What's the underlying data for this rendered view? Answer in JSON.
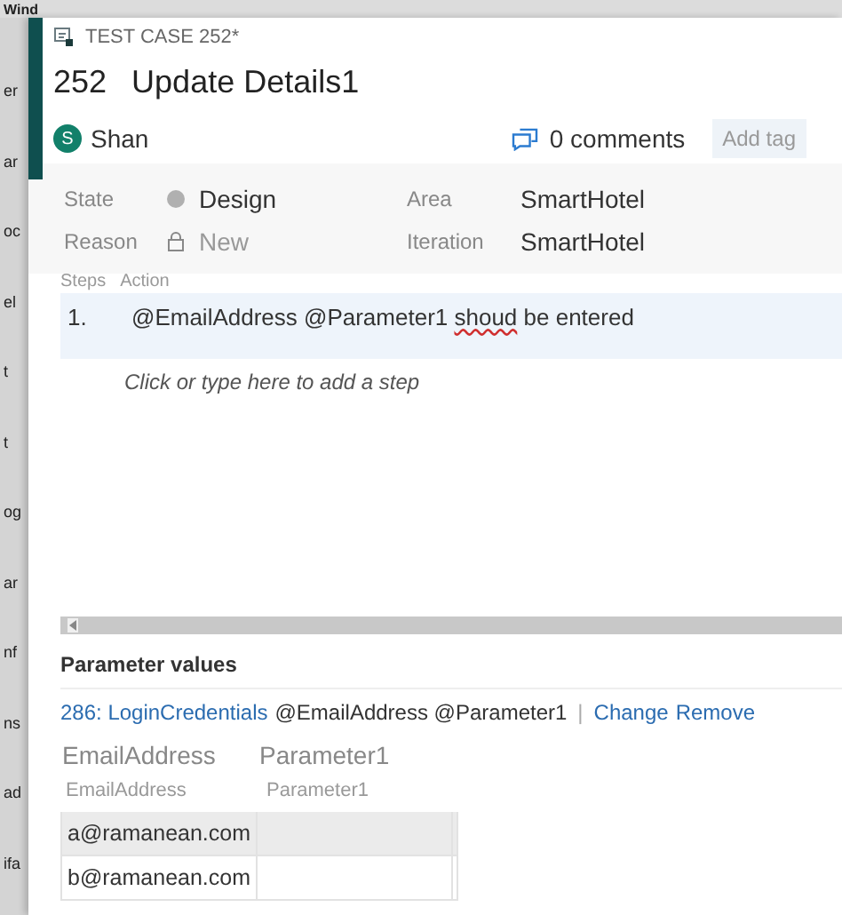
{
  "background": {
    "top_fragment": "Wind",
    "side_fragments": [
      "er",
      "ar",
      "oc",
      "el",
      "t",
      "t",
      "og",
      "ar",
      "nf",
      "ns",
      "ad",
      "ifa"
    ]
  },
  "work_item": {
    "type_label": "TEST CASE 252*",
    "id": "252",
    "title": "Update Details1",
    "assignee": {
      "initial": "S",
      "name": "Shan"
    },
    "comments": "0 comments",
    "add_tag": "Add tag"
  },
  "fields": [
    {
      "label": "State",
      "value": "Design",
      "kind": "state",
      "label2": "Area",
      "value2": "SmartHotel"
    },
    {
      "label": "Reason",
      "value": "New",
      "kind": "locked",
      "label2": "Iteration",
      "value2": "SmartHotel"
    }
  ],
  "steps": {
    "columns": [
      "Steps",
      "Action"
    ],
    "rows": [
      {
        "number": "1.",
        "selected": true,
        "segments": [
          {
            "text": "@EmailAddress @Parameter1 ",
            "spelling_error": false
          },
          {
            "text": "shoud",
            "spelling_error": true
          },
          {
            "text": " be entered",
            "spelling_error": false
          }
        ]
      }
    ],
    "add_step_placeholder": "Click or type here to add a step"
  },
  "parameters": {
    "heading": "Parameter values",
    "shared_set": "286: LoginCredentials",
    "set_params": "@EmailAddress @Parameter1",
    "separator": "|",
    "actions": [
      "Change",
      "Remove"
    ],
    "columns": [
      {
        "name": "EmailAddress",
        "subtitle": "EmailAddress"
      },
      {
        "name": "Parameter1",
        "subtitle": "Parameter1"
      }
    ],
    "rows": [
      {
        "cells": [
          "a@ramanean.com",
          ""
        ],
        "selected": true
      },
      {
        "cells": [
          "b@ramanean.com",
          ""
        ],
        "selected": false
      }
    ]
  }
}
